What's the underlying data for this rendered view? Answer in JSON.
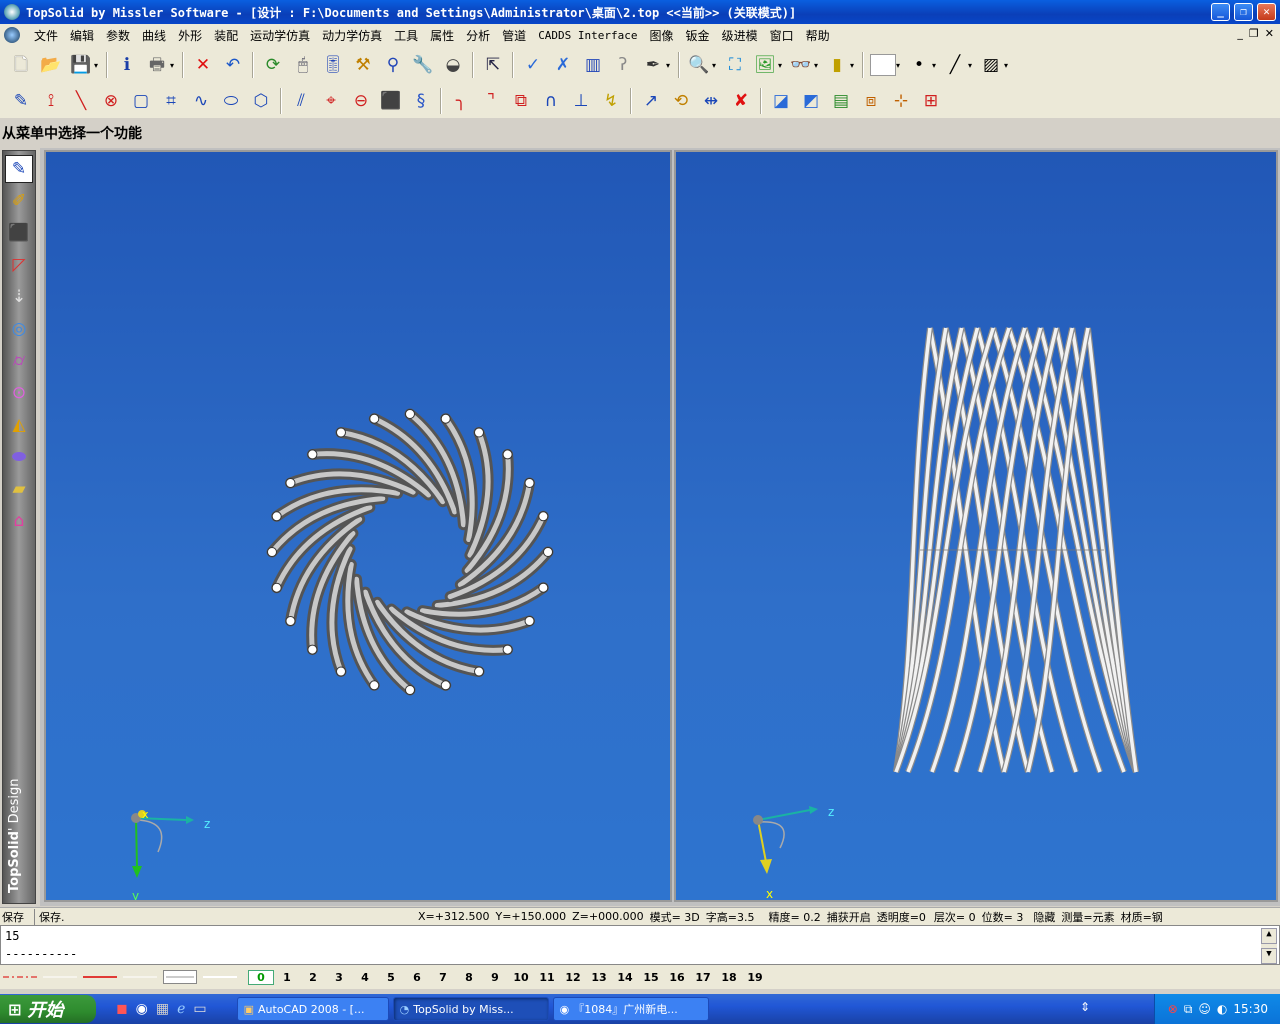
{
  "window": {
    "title": "TopSolid by Missler Software - [设计 : F:\\Documents and Settings\\Administrator\\桌面\\2.top  <<当前>> (关联模式)]",
    "min_label": "_",
    "max_label": "❐",
    "close_label": "✕"
  },
  "menu": {
    "items": [
      "文件",
      "编辑",
      "参数",
      "曲线",
      "外形",
      "装配",
      "运动学仿真",
      "动力学仿真",
      "工具",
      "属性",
      "分析",
      "管道",
      "CADDS Interface",
      "图像",
      "钣金",
      "级进模",
      "窗口",
      "帮助"
    ],
    "mdi_min": "_",
    "mdi_restore": "❐",
    "mdi_close": "✕"
  },
  "prompt": {
    "text": "从菜单中选择一个功能"
  },
  "brand": {
    "name": "TopSolid",
    "suffix": "' Design"
  },
  "viewL": {
    "axis_z": "z",
    "axis_y": "y",
    "axis_x": "x"
  },
  "viewR": {
    "axis_z": "z",
    "axis_x": "x"
  },
  "status": {
    "left1": "保存",
    "left2": "保存.",
    "x": "X=+312.500",
    "y": "Y=+150.000",
    "z": "Z=+000.000",
    "mode": "模式=  3D",
    "text_height": "字高=3.5",
    "precision": "精度=  0.2",
    "snap": "捕获开启",
    "transparency": "透明度=0",
    "level": "层次=  0",
    "digits": "位数= 3",
    "hide": "隐藏",
    "measure": "测量=元素",
    "material": "材质=钢"
  },
  "command": {
    "line1": "15",
    "line2": "----------"
  },
  "layers": [
    "0",
    "1",
    "2",
    "3",
    "4",
    "5",
    "6",
    "7",
    "8",
    "9",
    "10",
    "11",
    "12",
    "13",
    "14",
    "15",
    "16",
    "17",
    "18",
    "19"
  ],
  "taskbar": {
    "start": "开始",
    "tasks": [
      "AutoCAD 2008 - [...",
      "TopSolid by Miss...",
      "『1084』广州新电..."
    ],
    "clock": "15:30"
  },
  "colors": {
    "viewport": "#2a66c4",
    "title": "#0a4fd0",
    "taskbar": "#2157d6"
  }
}
